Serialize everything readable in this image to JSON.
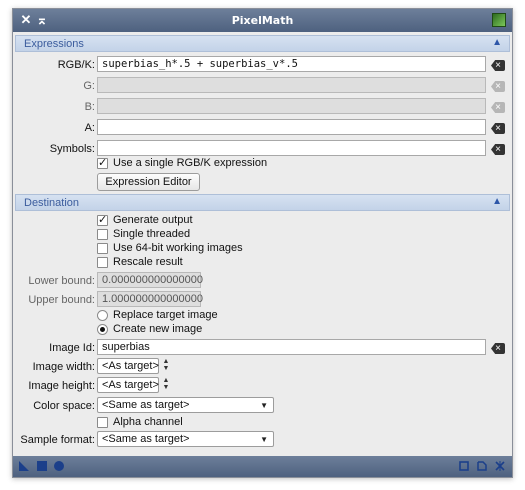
{
  "window": {
    "title": "PixelMath"
  },
  "expressions": {
    "section_label": "Expressions",
    "rgbk_label": "RGB/K:",
    "rgbk_value": "superbias_h*.5 + superbias_v*.5",
    "g_label": "G:",
    "b_label": "B:",
    "a_label": "A:",
    "symbols_label": "Symbols:",
    "single_rgbk_label": "Use a single RGB/K expression",
    "single_rgbk_checked": true,
    "expression_editor_label": "Expression Editor"
  },
  "destination": {
    "section_label": "Destination",
    "generate_output_label": "Generate output",
    "generate_output_checked": true,
    "single_threaded_label": "Single threaded",
    "use_64bit_label": "Use 64-bit working images",
    "rescale_label": "Rescale result",
    "lower_bound_label": "Lower bound:",
    "lower_bound_value": "0.000000000000000",
    "upper_bound_label": "Upper bound:",
    "upper_bound_value": "1.000000000000000",
    "replace_target_label": "Replace target image",
    "create_new_label": "Create new image",
    "selected_mode": "Create new image",
    "image_id_label": "Image Id:",
    "image_id_value": "superbias",
    "image_width_label": "Image width:",
    "image_width_value": "<As target>",
    "image_height_label": "Image height:",
    "image_height_value": "<As target>",
    "color_space_label": "Color space:",
    "color_space_value": "<Same as target>",
    "alpha_channel_label": "Alpha channel",
    "sample_format_label": "Sample format:",
    "sample_format_value": "<Same as target>"
  },
  "footer": {
    "icons_left": [
      "new-instance-icon",
      "apply-global-icon",
      "apply-icon"
    ],
    "icons_right": [
      "browse-documentation-icon",
      "reset-icon",
      "preferences-icon"
    ]
  },
  "colors": {
    "titlebar": "#5d6f8c",
    "section_bg": "#cfdcee",
    "section_text": "#3b5c9d",
    "accent": "#2d56a8"
  }
}
